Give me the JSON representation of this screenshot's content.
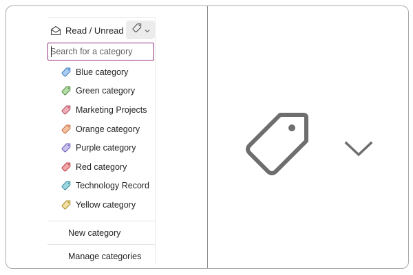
{
  "toolbar": {
    "read_unread_label": "Read / Unread",
    "read_icon": "envelope-open-icon",
    "tag_icon": "tag-icon",
    "chevron_icon": "chevron-down-icon"
  },
  "search": {
    "placeholder": "Search for a category",
    "value": ""
  },
  "categories": [
    {
      "label": "Blue category",
      "color": "#a9cdf0",
      "stroke": "#3a78b8"
    },
    {
      "label": "Green category",
      "color": "#b6dca8",
      "stroke": "#4d8a3c"
    },
    {
      "label": "Marketing Projects",
      "color": "#eeb0b8",
      "stroke": "#b0485a"
    },
    {
      "label": "Orange category",
      "color": "#f4c2a2",
      "stroke": "#c0683a"
    },
    {
      "label": "Purple category",
      "color": "#c9c2ee",
      "stroke": "#6a5ab8"
    },
    {
      "label": "Red category",
      "color": "#f1a7a9",
      "stroke": "#b83a40"
    },
    {
      "label": "Technology Record",
      "color": "#9ed6df",
      "stroke": "#2f8a99"
    },
    {
      "label": "Yellow category",
      "color": "#f1dea0",
      "stroke": "#a88a2a"
    }
  ],
  "actions": {
    "new_category": "New category",
    "manage_categories": "Manage categories"
  },
  "colors": {
    "search_border": "#8f2d7f",
    "tag_button_bg": "#ececec"
  }
}
